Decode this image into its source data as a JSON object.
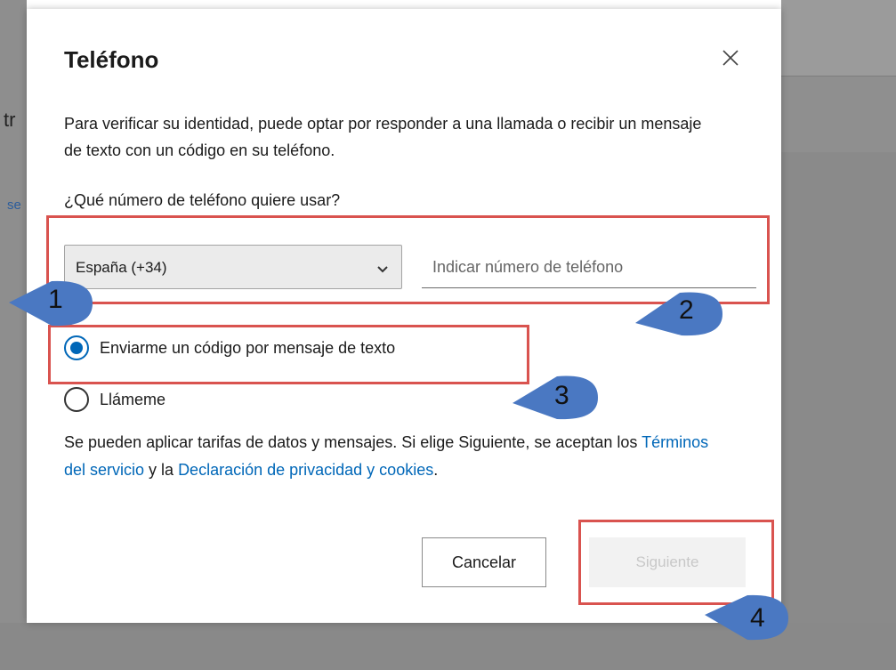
{
  "background": {
    "frag_left": "tr",
    "frag_link": "se"
  },
  "dialog": {
    "title": "Teléfono",
    "close_icon": "close-icon",
    "description": "Para verificar su identidad, puede optar por responder a una llamada o recibir un mensaje de texto con un código en su teléfono.",
    "question": "¿Qué número de teléfono quiere usar?",
    "country_select": {
      "selected": "España (+34)",
      "icon": "chevron-down-icon"
    },
    "phone_input": {
      "value": "",
      "placeholder": "Indicar número de teléfono"
    },
    "options": [
      {
        "label": "Enviarme un código por mensaje de texto",
        "checked": true
      },
      {
        "label": "Llámeme",
        "checked": false
      }
    ],
    "terms": {
      "prefix": "Se pueden aplicar tarifas de datos y mensajes. Si elige Siguiente, se aceptan los ",
      "link1": "Términos del servicio",
      "middle": " y la ",
      "link2": "Declaración de privacidad y cookies",
      "suffix": "."
    },
    "buttons": {
      "cancel": "Cancelar",
      "next": "Siguiente"
    }
  },
  "annotations": {
    "callouts": [
      "1",
      "2",
      "3",
      "4"
    ],
    "highlight_color": "#d9534f",
    "callout_color": "#4a78c2"
  },
  "colors": {
    "accent": "#0067b8",
    "overlay": "#8a8a8a"
  }
}
